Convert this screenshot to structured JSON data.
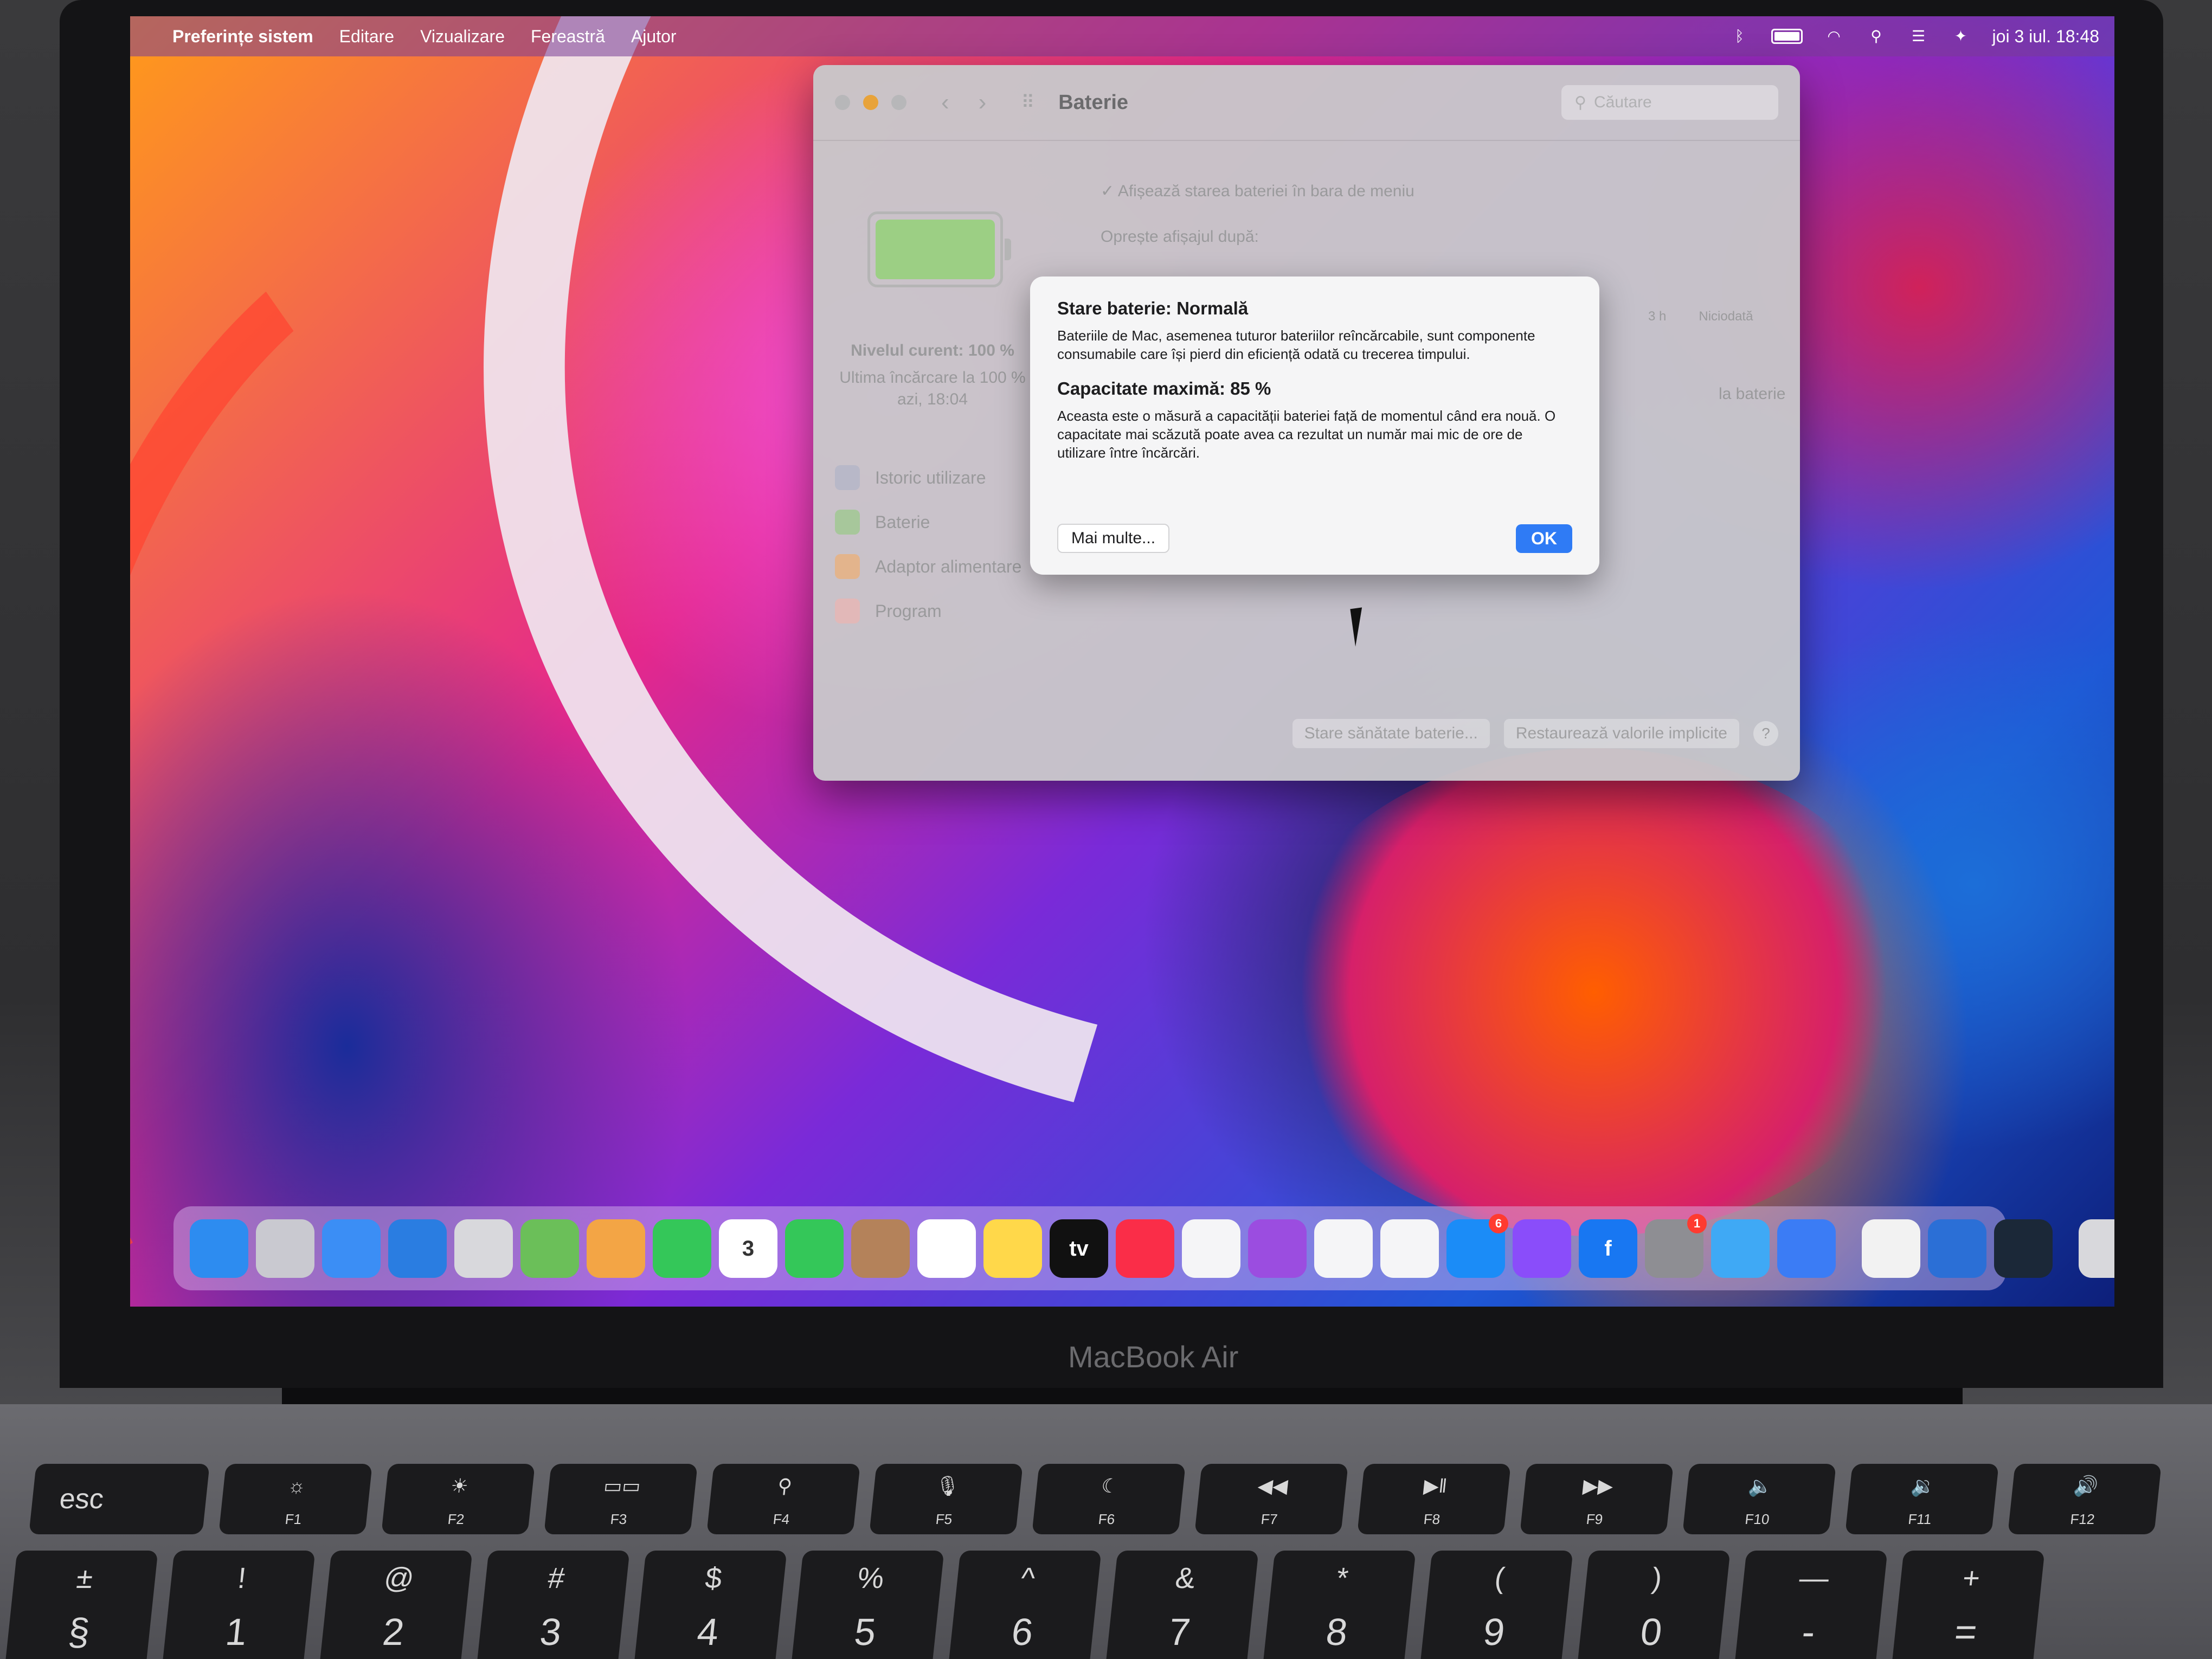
{
  "menubar": {
    "apple": "",
    "items": [
      "Preferințe sistem",
      "Editare",
      "Vizualizare",
      "Fereastră",
      "Ajutor"
    ],
    "clock": "joi 3 iul.  18:48"
  },
  "window": {
    "title": "Baterie",
    "search_placeholder": "Căutare",
    "show_status": "Afișează starea bateriei în bara de meniu",
    "display_off": "Oprește afișajul după:",
    "slider_labels": [
      "3 h",
      "Niciodată"
    ],
    "level": "Nivelul curent: 100 %",
    "last_charge": "Ultima încărcare la 100 %",
    "last_charge_date": "azi, 18:04",
    "sidebar": [
      "Istoric utilizare",
      "Baterie",
      "Adaptor alimentare",
      "Program"
    ],
    "right_label": "la baterie",
    "buttons": {
      "health": "Stare sănătate baterie...",
      "restore": "Restaurează valorile implicite",
      "help": "?"
    }
  },
  "alert": {
    "title": "Stare baterie: Normală",
    "body": "Bateriile de Mac, asemenea tuturor bateriilor reîncărcabile, sunt componente consumabile care își pierd din eficiență odată cu trecerea timpului.",
    "capacity_title": "Capacitate maximă: 85 %",
    "capacity_body": "Aceasta este o măsură a capacității bateriei față de momentul când era nouă. O capacitate mai scăzută poate avea ca rezultat un număr mai mic de ore de utilizare între încărcări.",
    "more_button": "Mai multe...",
    "ok_button": "OK"
  },
  "dock": {
    "apps": [
      {
        "name": "finder",
        "color": "#2d8cf0"
      },
      {
        "name": "launchpad",
        "color": "#c9c9d0"
      },
      {
        "name": "mail",
        "color": "#3b8ef5"
      },
      {
        "name": "safari",
        "color": "#2a7de1"
      },
      {
        "name": "notes-stack",
        "color": "#d8d8dc"
      },
      {
        "name": "maps",
        "color": "#6bbf59"
      },
      {
        "name": "photos",
        "color": "#f3a545"
      },
      {
        "name": "facetime",
        "color": "#34c759"
      },
      {
        "name": "calendar",
        "color": "#ffffff",
        "text": "3"
      },
      {
        "name": "messages",
        "color": "#34c759"
      },
      {
        "name": "contacts",
        "color": "#b4825a"
      },
      {
        "name": "reminders",
        "color": "#ffffff"
      },
      {
        "name": "notes",
        "color": "#ffd84a"
      },
      {
        "name": "tv",
        "color": "#111111",
        "text": "tv"
      },
      {
        "name": "music",
        "color": "#fa2d48"
      },
      {
        "name": "keynote",
        "color": "#f5f5f7"
      },
      {
        "name": "podcasts",
        "color": "#9b4de0"
      },
      {
        "name": "numbers",
        "color": "#f5f5f7"
      },
      {
        "name": "pages",
        "color": "#f5f5f7"
      },
      {
        "name": "app-store",
        "color": "#1b8cf7",
        "badge": "6"
      },
      {
        "name": "messenger",
        "color": "#8a4dfa"
      },
      {
        "name": "facebook",
        "color": "#1877f2",
        "text": "f"
      },
      {
        "name": "system-preferences",
        "color": "#8e8e93",
        "badge": "1"
      },
      {
        "name": "xcode-like",
        "color": "#3fa9f5"
      },
      {
        "name": "roblox",
        "color": "#3b7cf5"
      },
      {
        "sep": true
      },
      {
        "name": "chrome",
        "color": "#f2f2f2"
      },
      {
        "name": "quicktime",
        "color": "#2b6fd6"
      },
      {
        "name": "steam",
        "color": "#1b2838"
      },
      {
        "sep": true
      },
      {
        "name": "trash",
        "color": "#d8d8dc"
      }
    ]
  },
  "device_label": "MacBook Air",
  "keyboard": {
    "esc": "esc",
    "fkeys": [
      {
        "icon": "☼",
        "label": "F1"
      },
      {
        "icon": "☀",
        "label": "F2"
      },
      {
        "icon": "▭▭",
        "label": "F3"
      },
      {
        "icon": "⚲",
        "label": "F4"
      },
      {
        "icon": "🎙",
        "label": "F5"
      },
      {
        "icon": "☾",
        "label": "F6"
      },
      {
        "icon": "◀◀",
        "label": "F7"
      },
      {
        "icon": "▶‖",
        "label": "F8"
      },
      {
        "icon": "▶▶",
        "label": "F9"
      },
      {
        "icon": "🔈",
        "label": "F10"
      },
      {
        "icon": "🔉",
        "label": "F11"
      },
      {
        "icon": "🔊",
        "label": "F12"
      }
    ],
    "numkeys": [
      {
        "top": "±",
        "bot": "§"
      },
      {
        "top": "!",
        "bot": "1"
      },
      {
        "top": "@",
        "bot": "2"
      },
      {
        "top": "#",
        "bot": "3"
      },
      {
        "top": "$",
        "bot": "4"
      },
      {
        "top": "%",
        "bot": "5"
      },
      {
        "top": "^",
        "bot": "6"
      },
      {
        "top": "&",
        "bot": "7"
      },
      {
        "top": "*",
        "bot": "8"
      },
      {
        "top": "(",
        "bot": "9"
      },
      {
        "top": ")",
        "bot": "0"
      },
      {
        "top": "—",
        "bot": "-"
      },
      {
        "top": "+",
        "bot": "="
      }
    ]
  }
}
